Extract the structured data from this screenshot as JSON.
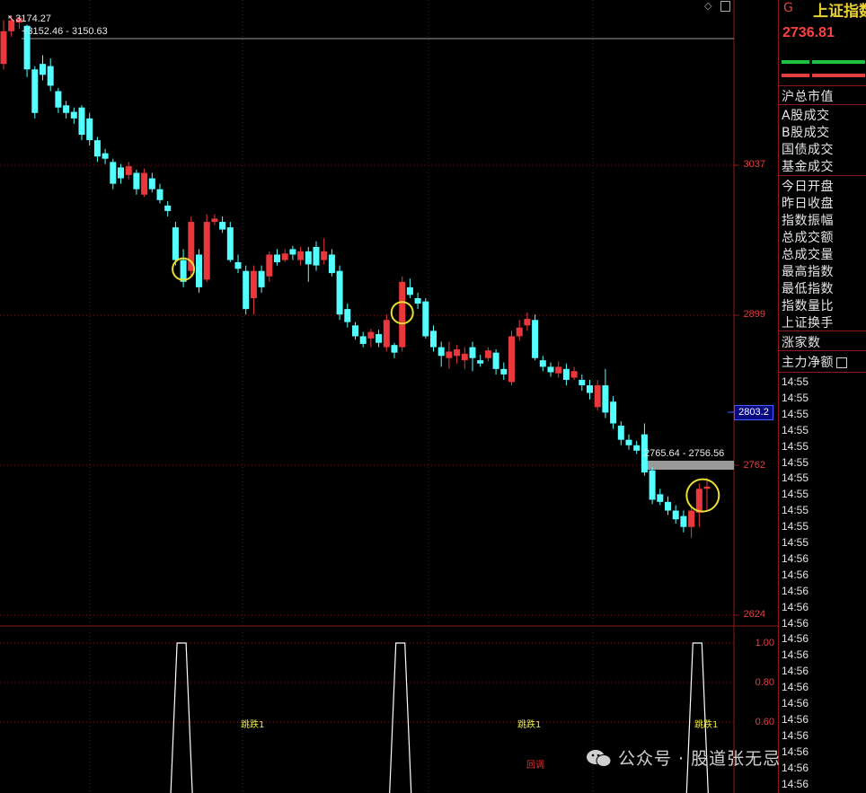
{
  "chart_header": {
    "high_label": "3174.27",
    "range_top_label": "3152.46 - 3150.63"
  },
  "chart_data": {
    "type": "candlestick",
    "ylim": [
      2624,
      3174.27
    ],
    "ticks": [
      "3037",
      "2899",
      "2762",
      "2624"
    ],
    "cursor_price": "2803.2",
    "range_label": "2765.64 - 2756.56",
    "candles": [
      {
        "o": 3130,
        "c": 3160,
        "h": 3170,
        "l": 3125
      },
      {
        "o": 3160,
        "c": 3170,
        "h": 3174,
        "l": 3155
      },
      {
        "o": 3168,
        "c": 3172,
        "h": 3174,
        "l": 3162
      },
      {
        "o": 3165,
        "c": 3125,
        "h": 3166,
        "l": 3118
      },
      {
        "o": 3125,
        "c": 3085,
        "h": 3128,
        "l": 3080
      },
      {
        "o": 3130,
        "c": 3120,
        "h": 3138,
        "l": 3115
      },
      {
        "o": 3128,
        "c": 3110,
        "h": 3135,
        "l": 3105
      },
      {
        "o": 3105,
        "c": 3090,
        "h": 3108,
        "l": 3085
      },
      {
        "o": 3092,
        "c": 3085,
        "h": 3096,
        "l": 3080
      },
      {
        "o": 3086,
        "c": 3080,
        "h": 3090,
        "l": 3075
      },
      {
        "o": 3090,
        "c": 3065,
        "h": 3092,
        "l": 3060
      },
      {
        "o": 3080,
        "c": 3060,
        "h": 3085,
        "l": 3055
      },
      {
        "o": 3060,
        "c": 3045,
        "h": 3063,
        "l": 3040
      },
      {
        "o": 3048,
        "c": 3043,
        "h": 3052,
        "l": 3038
      },
      {
        "o": 3040,
        "c": 3020,
        "h": 3043,
        "l": 3015
      },
      {
        "o": 3035,
        "c": 3025,
        "h": 3038,
        "l": 3020
      },
      {
        "o": 3028,
        "c": 3036,
        "h": 3040,
        "l": 3024
      },
      {
        "o": 3030,
        "c": 3015,
        "h": 3033,
        "l": 3010
      },
      {
        "o": 3010,
        "c": 3030,
        "h": 3034,
        "l": 3008
      },
      {
        "o": 3025,
        "c": 3015,
        "h": 3030,
        "l": 3012
      },
      {
        "o": 3015,
        "c": 3005,
        "h": 3020,
        "l": 3002
      },
      {
        "o": 3000,
        "c": 2995,
        "h": 3004,
        "l": 2990
      },
      {
        "o": 2980,
        "c": 2950,
        "h": 2985,
        "l": 2945
      },
      {
        "o": 2950,
        "c": 2930,
        "h": 2960,
        "l": 2925
      },
      {
        "o": 2940,
        "c": 2985,
        "h": 2990,
        "l": 2936
      },
      {
        "o": 2955,
        "c": 2925,
        "h": 2960,
        "l": 2920
      },
      {
        "o": 2932,
        "c": 2985,
        "h": 2992,
        "l": 2930
      },
      {
        "o": 2985,
        "c": 2988,
        "h": 2992,
        "l": 2982
      },
      {
        "o": 2985,
        "c": 2978,
        "h": 2990,
        "l": 2975
      },
      {
        "o": 2980,
        "c": 2950,
        "h": 2985,
        "l": 2948
      },
      {
        "o": 2948,
        "c": 2942,
        "h": 2955,
        "l": 2938
      },
      {
        "o": 2940,
        "c": 2905,
        "h": 2945,
        "l": 2900
      },
      {
        "o": 2915,
        "c": 2940,
        "h": 2945,
        "l": 2900
      },
      {
        "o": 2940,
        "c": 2925,
        "h": 2945,
        "l": 2920
      },
      {
        "o": 2935,
        "c": 2955,
        "h": 2958,
        "l": 2930
      },
      {
        "o": 2955,
        "c": 2948,
        "h": 2960,
        "l": 2945
      },
      {
        "o": 2950,
        "c": 2956,
        "h": 2960,
        "l": 2948
      },
      {
        "o": 2960,
        "c": 2955,
        "h": 2963,
        "l": 2950
      },
      {
        "o": 2950,
        "c": 2958,
        "h": 2962,
        "l": 2945
      },
      {
        "o": 2958,
        "c": 2946,
        "h": 2962,
        "l": 2930
      },
      {
        "o": 2962,
        "c": 2945,
        "h": 2967,
        "l": 2940
      },
      {
        "o": 2950,
        "c": 2958,
        "h": 2970,
        "l": 2946
      },
      {
        "o": 2955,
        "c": 2938,
        "h": 2960,
        "l": 2935
      },
      {
        "o": 2940,
        "c": 2900,
        "h": 2945,
        "l": 2895
      },
      {
        "o": 2905,
        "c": 2893,
        "h": 2910,
        "l": 2888
      },
      {
        "o": 2890,
        "c": 2880,
        "h": 2893,
        "l": 2877
      },
      {
        "o": 2880,
        "c": 2873,
        "h": 2884,
        "l": 2870
      },
      {
        "o": 2878,
        "c": 2884,
        "h": 2887,
        "l": 2870
      },
      {
        "o": 2882,
        "c": 2874,
        "h": 2886,
        "l": 2870
      },
      {
        "o": 2870,
        "c": 2895,
        "h": 2900,
        "l": 2866
      },
      {
        "o": 2872,
        "c": 2865,
        "h": 2874,
        "l": 2860
      },
      {
        "o": 2870,
        "c": 2930,
        "h": 2935,
        "l": 2866
      },
      {
        "o": 2925,
        "c": 2918,
        "h": 2933,
        "l": 2915
      },
      {
        "o": 2915,
        "c": 2910,
        "h": 2920,
        "l": 2905
      },
      {
        "o": 2912,
        "c": 2880,
        "h": 2915,
        "l": 2878
      },
      {
        "o": 2885,
        "c": 2870,
        "h": 2890,
        "l": 2866
      },
      {
        "o": 2870,
        "c": 2862,
        "h": 2875,
        "l": 2852
      },
      {
        "o": 2860,
        "c": 2866,
        "h": 2875,
        "l": 2850
      },
      {
        "o": 2862,
        "c": 2868,
        "h": 2872,
        "l": 2855
      },
      {
        "o": 2858,
        "c": 2864,
        "h": 2870,
        "l": 2850
      },
      {
        "o": 2870,
        "c": 2860,
        "h": 2875,
        "l": 2848
      },
      {
        "o": 2858,
        "c": 2855,
        "h": 2863,
        "l": 2852
      },
      {
        "o": 2860,
        "c": 2867,
        "h": 2870,
        "l": 2857
      },
      {
        "o": 2865,
        "c": 2850,
        "h": 2868,
        "l": 2845
      },
      {
        "o": 2850,
        "c": 2845,
        "h": 2856,
        "l": 2840
      },
      {
        "o": 2838,
        "c": 2880,
        "h": 2885,
        "l": 2835
      },
      {
        "o": 2880,
        "c": 2888,
        "h": 2895,
        "l": 2876
      },
      {
        "o": 2890,
        "c": 2896,
        "h": 2902,
        "l": 2885
      },
      {
        "o": 2895,
        "c": 2860,
        "h": 2900,
        "l": 2858
      },
      {
        "o": 2858,
        "c": 2852,
        "h": 2862,
        "l": 2848
      },
      {
        "o": 2852,
        "c": 2847,
        "h": 2856,
        "l": 2843
      },
      {
        "o": 2846,
        "c": 2852,
        "h": 2857,
        "l": 2842
      },
      {
        "o": 2850,
        "c": 2840,
        "h": 2855,
        "l": 2835
      },
      {
        "o": 2842,
        "c": 2848,
        "h": 2852,
        "l": 2840
      },
      {
        "o": 2840,
        "c": 2835,
        "h": 2845,
        "l": 2830
      },
      {
        "o": 2835,
        "c": 2828,
        "h": 2840,
        "l": 2822
      },
      {
        "o": 2815,
        "c": 2835,
        "h": 2840,
        "l": 2812
      },
      {
        "o": 2835,
        "c": 2810,
        "h": 2850,
        "l": 2805
      },
      {
        "o": 2820,
        "c": 2800,
        "h": 2825,
        "l": 2795
      },
      {
        "o": 2798,
        "c": 2785,
        "h": 2802,
        "l": 2780
      },
      {
        "o": 2785,
        "c": 2780,
        "h": 2790,
        "l": 2776
      },
      {
        "o": 2780,
        "c": 2775,
        "h": 2784,
        "l": 2772
      },
      {
        "o": 2790,
        "c": 2755,
        "h": 2800,
        "l": 2752
      },
      {
        "o": 2757,
        "c": 2730,
        "h": 2760,
        "l": 2726
      },
      {
        "o": 2735,
        "c": 2728,
        "h": 2740,
        "l": 2725
      },
      {
        "o": 2728,
        "c": 2720,
        "h": 2733,
        "l": 2716
      },
      {
        "o": 2720,
        "c": 2712,
        "h": 2725,
        "l": 2708
      },
      {
        "o": 2715,
        "c": 2705,
        "h": 2720,
        "l": 2700
      },
      {
        "o": 2705,
        "c": 2720,
        "h": 2725,
        "l": 2695
      },
      {
        "o": 2718,
        "c": 2740,
        "h": 2745,
        "l": 2705
      },
      {
        "o": 2740,
        "c": 2742,
        "h": 2750,
        "l": 2720
      }
    ],
    "circled_candles": [
      23,
      51,
      89
    ],
    "signal": {
      "ticks": [
        "1.00",
        "0.80",
        "0.60"
      ],
      "spikes_at": [
        23,
        51,
        89
      ],
      "spike_label": "跳跌1",
      "red_label": "回调"
    }
  },
  "panel": {
    "g_label": "G",
    "title": "上证指数",
    "price": "2736.81",
    "bar_green": "#20c040",
    "bar_red": "#e04040",
    "rows": [
      "沪总市值",
      "A股成交",
      "B股成交",
      "国债成交",
      "基金成交",
      "今日开盘",
      "昨日收盘",
      "指数振幅",
      "总成交额",
      "总成交量",
      "最高指数",
      "最低指数",
      "指数量比",
      "上证换手",
      "涨家数",
      "主力净额"
    ],
    "times": [
      "14:55",
      "14:55",
      "14:55",
      "14:55",
      "14:55",
      "14:55",
      "14:55",
      "14:55",
      "14:55",
      "14:55",
      "14:55",
      "14:56",
      "14:56",
      "14:56",
      "14:56",
      "14:56",
      "14:56",
      "14:56",
      "14:56",
      "14:56",
      "14:56",
      "14:56",
      "14:56",
      "14:56",
      "14:56",
      "14:56"
    ]
  },
  "colors": {
    "up": "#e8383c",
    "down": "#54ffff",
    "circle": "#e6e030",
    "axis_border": "#8b1a1a"
  },
  "watermark": "公众号 · 股道张无忌"
}
